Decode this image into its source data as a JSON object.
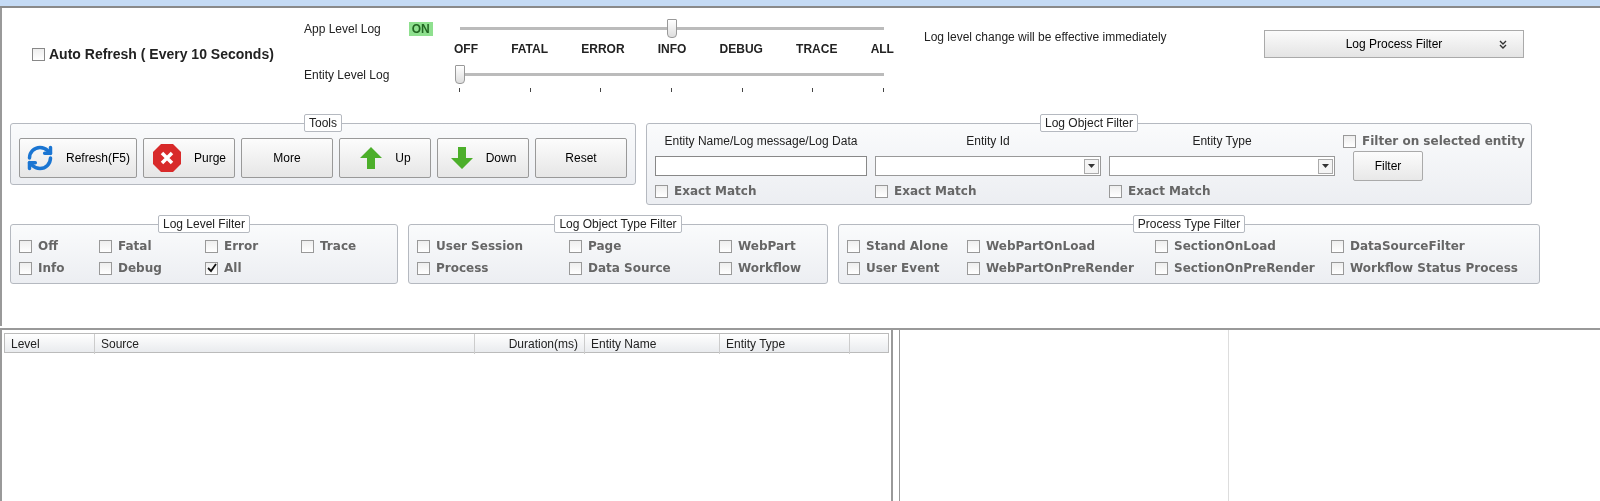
{
  "auto_refresh": {
    "label": "Auto Refresh ( Every 10 Seconds)",
    "checked": false
  },
  "app_level_log": {
    "label": "App Level Log",
    "status": "ON",
    "level": 0.5
  },
  "level_labels": [
    "OFF",
    "FATAL",
    "ERROR",
    "INFO",
    "DEBUG",
    "TRACE",
    "ALL"
  ],
  "entity_level_log": {
    "label": "Entity Level Log",
    "level": 0
  },
  "note": "Log level change will be effective immediately",
  "log_process_filter": {
    "label": "Log Process Filter"
  },
  "tools": {
    "title": "Tools",
    "buttons": [
      {
        "label": "Refresh(F5)",
        "kind": "refresh"
      },
      {
        "label": "Purge",
        "kind": "purge"
      },
      {
        "label": "More",
        "kind": "plain"
      },
      {
        "label": "Up",
        "kind": "up"
      },
      {
        "label": "Down",
        "kind": "down"
      },
      {
        "label": "Reset",
        "kind": "plain"
      }
    ]
  },
  "log_object_filter": {
    "title": "Log Object Filter",
    "fields": [
      {
        "label": "Entity Name/Log message/Log Data",
        "kind": "text",
        "exact_match": {
          "label": "Exact Match",
          "checked": false
        }
      },
      {
        "label": "Entity Id",
        "kind": "dropdown",
        "exact_match": {
          "label": "Exact Match",
          "checked": false
        }
      },
      {
        "label": "Entity Type",
        "kind": "dropdown",
        "exact_match": {
          "label": "Exact Match",
          "checked": false
        }
      }
    ],
    "filter_on_selected": {
      "label": "Filter on selected entity",
      "checked": false
    },
    "button": "Filter"
  },
  "log_level_filter": {
    "title": "Log Level Filter",
    "options": [
      {
        "label": "Off",
        "checked": false
      },
      {
        "label": "Fatal",
        "checked": false
      },
      {
        "label": "Error",
        "checked": false
      },
      {
        "label": "Trace",
        "checked": false
      },
      {
        "label": "Info",
        "checked": false
      },
      {
        "label": "Debug",
        "checked": false
      },
      {
        "label": "All",
        "checked": true
      }
    ]
  },
  "log_object_type_filter": {
    "title": "Log Object Type Filter",
    "options": [
      {
        "label": "User Session",
        "checked": false
      },
      {
        "label": "Page",
        "checked": false
      },
      {
        "label": "WebPart",
        "checked": false
      },
      {
        "label": "Process",
        "checked": false
      },
      {
        "label": "Data Source",
        "checked": false
      },
      {
        "label": "Workflow",
        "checked": false
      }
    ]
  },
  "process_type_filter": {
    "title": "Process Type Filter",
    "options": [
      {
        "label": "Stand Alone",
        "checked": false
      },
      {
        "label": "WebPartOnLoad",
        "checked": false
      },
      {
        "label": "SectionOnLoad",
        "checked": false
      },
      {
        "label": "DataSourceFilter",
        "checked": false
      },
      {
        "label": "User Event",
        "checked": false
      },
      {
        "label": "WebPartOnPreRender",
        "checked": false
      },
      {
        "label": "SectionOnPreRender",
        "checked": false
      },
      {
        "label": "Workflow Status Process",
        "checked": false
      }
    ]
  },
  "log_grid": {
    "columns": [
      "Level",
      "Source",
      "Duration(ms)",
      "Entity Name",
      "Entity Type"
    ]
  }
}
